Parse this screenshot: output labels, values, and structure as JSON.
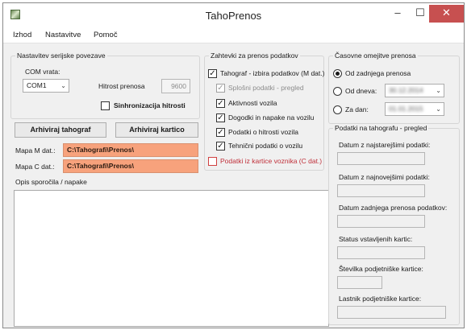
{
  "window": {
    "title": "TahoPrenos",
    "minimize": "–",
    "maximize": "☐",
    "close": "✕"
  },
  "menu": [
    "Izhod",
    "Nastavitve",
    "Pomoč"
  ],
  "serial": {
    "legend": "Nastavitev serijske povezave",
    "com_label": "COM vrata:",
    "com_value": "COM1",
    "speed_label": "Hitrost prenosa",
    "speed_value": "9600",
    "sync_label": "Sinhronizacija hitrosti",
    "sync_checked": false
  },
  "buttons": {
    "archive_tacho": "Arhiviraj tahograf",
    "archive_card": "Arhiviraj kartico"
  },
  "paths": {
    "m_label": "Mapa M dat.:",
    "m_value": "C:\\Tahografi\\Prenos\\",
    "c_label": "Mapa C dat.:",
    "c_value": "C:\\Tahografi\\Prenos\\"
  },
  "log_label": "Opis sporočila / napake",
  "transfer": {
    "legend": "Zahtevki za prenos podatkov",
    "tachograph": "Tahograf - izbira podatkov (M dat.)",
    "general": "Splošni podatki - pregled",
    "activity": "Aktivnosti vozila",
    "events": "Dogodki in napake na vozilu",
    "speed": "Podatki o hitrosti vozila",
    "technical": "Tehnični podatki o vozilu",
    "driver_card": "Podatki iz kartice voznika (C dat.)",
    "checkmark": "✓"
  },
  "time_limits": {
    "legend": "Časovne omejitve prenosa",
    "since_last": "Od zadnjega prenosa",
    "since_date": "Od dneva:",
    "since_date_value": "30.12.2014",
    "for_day": "Za dan:",
    "for_day_value": "01.01.2015"
  },
  "overview": {
    "legend": "Podatki na tahografu - pregled",
    "oldest": "Datum z najstarejšimi podatki:",
    "newest": "Datum z najnovejšimi podatki:",
    "last_transfer": "Datum zadnjega prenosa podatkov:",
    "card_status": "Status vstavljenih kartic:",
    "company_card_no": "Številka podjetniške kartice:",
    "company_card_owner": "Lastnik podjetniške kartice:"
  },
  "colors": {
    "path_bg": "#f7a27c",
    "close_bg": "#c75050",
    "red_text": "#c0303a"
  }
}
